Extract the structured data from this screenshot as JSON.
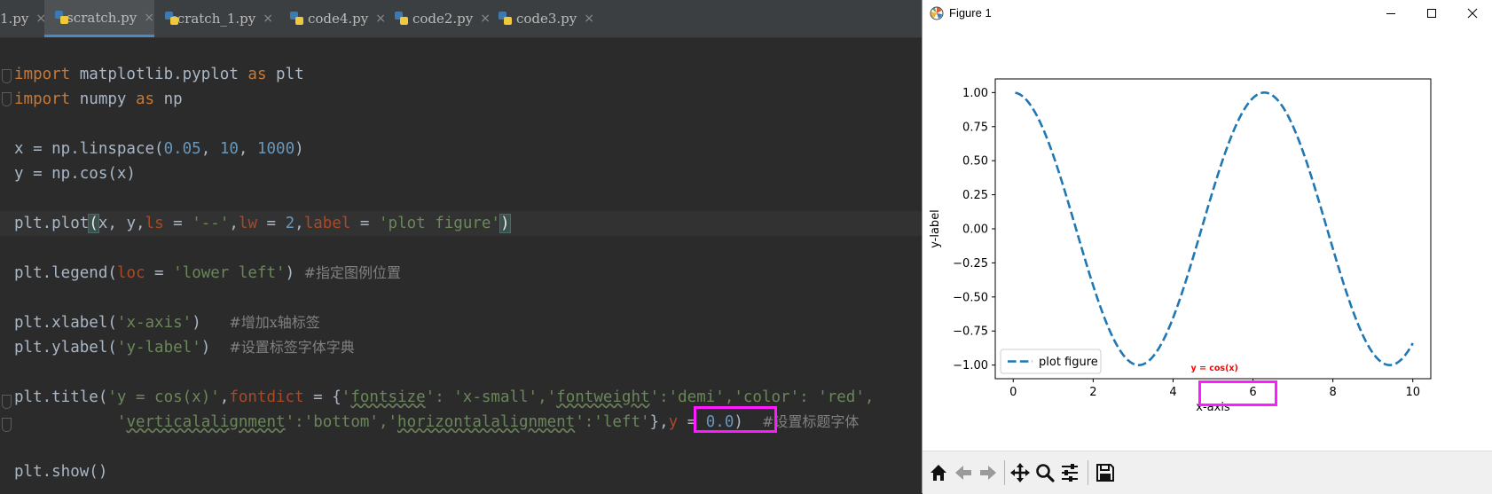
{
  "ide": {
    "tabs": [
      {
        "label": "1.py",
        "active": false
      },
      {
        "label": "scratch.py",
        "active": true
      },
      {
        "label": "scratch_1.py",
        "active": false
      },
      {
        "label": "code4.py",
        "active": false
      },
      {
        "label": "code2.py",
        "active": false
      },
      {
        "label": "code3.py",
        "active": false
      }
    ],
    "close_glyph": "×",
    "code": {
      "l1": {
        "kw1": "import",
        "mid": " matplotlib.pyplot ",
        "kw2": "as",
        "end": " plt"
      },
      "l2": {
        "kw1": "import",
        "mid": " numpy ",
        "kw2": "as",
        "end": " np"
      },
      "l3": {
        "a": "x = np.linspace(",
        "n1": "0.05",
        "c1": ", ",
        "n2": "10",
        "c2": ", ",
        "n3": "1000",
        "b": ")"
      },
      "l4": {
        "a": "y = np.cos(x)"
      },
      "l5": {
        "a": "plt.plot",
        "open": "(",
        "b": "x, y,",
        "p1": "ls",
        "e1": " = ",
        "s1": "'--'",
        "c1": ",",
        "p2": "lw",
        "e2": " = ",
        "n1": "2",
        "c2": ",",
        "p3": "label",
        "e3": " = ",
        "s2": "'plot figure'",
        "close": ")"
      },
      "l6": {
        "a": "plt.legend(",
        "p1": "loc",
        "e1": " = ",
        "s1": "'lower left'",
        "b": ") ",
        "cm": "#指定图例位置"
      },
      "l7": {
        "a": "plt.xlabel(",
        "s1": "'x-axis'",
        "b": ")   ",
        "cm": "#增加x轴标签"
      },
      "l8": {
        "a": "plt.ylabel(",
        "s1": "'y-label'",
        "b": ")  ",
        "cm": "#设置标签字体字典"
      },
      "l9": {
        "a": "plt.title(",
        "s1": "'y = cos(x)'",
        "b": ",",
        "p1": "fontdict",
        "e1": " = {",
        "q1": "'",
        "w1": "fontsize",
        "q2": "'",
        "s2": ": 'x-small',",
        "q3": "'",
        "w2": "fontweight",
        "q4": "'",
        "s3": ":'demi','color': 'red',"
      },
      "l10": {
        "indent": "           ",
        "q1": "'",
        "w1": "verticalalignment",
        "q2": "'",
        "s1": ":'bottom',",
        "q3": "'",
        "w2": "horizontalalignment",
        "q4": "'",
        "s2": ":'left'",
        "b": "},",
        "p1": "y",
        "e1": " = ",
        "n1": "0.0",
        "c": ")  ",
        "cm": "#设置标题字体"
      },
      "l11": {
        "a": "plt.show()"
      }
    },
    "colors": {
      "keyword": "#cc7832",
      "number": "#6897bb",
      "string": "#6a8759",
      "param": "#aa4926",
      "comment": "#808080",
      "highlight": "#ff1aff"
    }
  },
  "figure": {
    "window_title": "Figure 1",
    "toolbar_icons": [
      "home-icon",
      "back-arrow-icon",
      "forward-arrow-icon",
      "pan-icon",
      "zoom-icon",
      "configure-subplots-icon",
      "save-icon"
    ]
  },
  "chart_data": {
    "type": "line",
    "title": "y = cos(x)",
    "title_color": "#ff0000",
    "xlabel": "x-axis",
    "ylabel": "y-label",
    "xlim": [
      -0.45,
      10.45
    ],
    "ylim": [
      -1.1,
      1.1
    ],
    "xticks": [
      "0",
      "2",
      "4",
      "6",
      "8",
      "10"
    ],
    "yticks": [
      "−1.00",
      "−0.75",
      "−0.50",
      "−0.25",
      "0.00",
      "0.25",
      "0.50",
      "0.75",
      "1.00"
    ],
    "series": [
      {
        "name": "plot figure",
        "function": "cos",
        "x_start": 0.05,
        "x_end": 10,
        "points": 1000,
        "color": "#1f77b4",
        "linestyle": "dashed"
      }
    ],
    "legend": {
      "loc": "lower-left"
    },
    "grid": false
  }
}
